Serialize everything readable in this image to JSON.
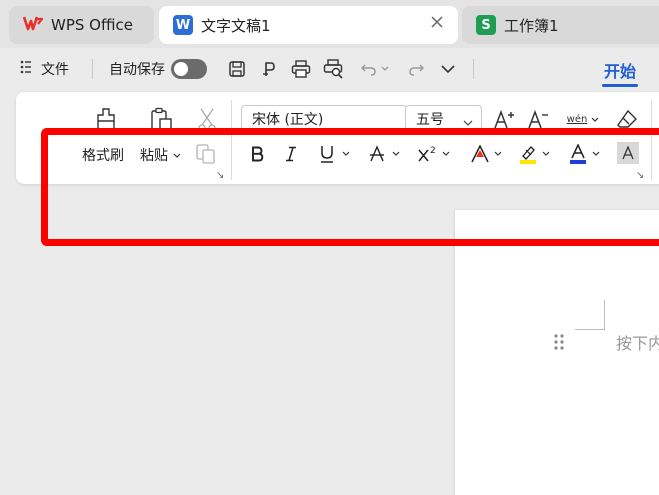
{
  "tabs": {
    "wps_label": "WPS Office",
    "doc_label": "文字文稿1",
    "sheet_label": "工作簿1",
    "doc_logo": "W",
    "sheet_logo": "S"
  },
  "menu": {
    "file_label": "文件",
    "autosave_label": "自动保存",
    "start_tab_label": "开始"
  },
  "ribbon": {
    "font_name": "宋体 (正文)",
    "font_size": "五号",
    "format_painter_label": "格式刷",
    "paste_label": "粘贴",
    "phonetic_label": "wén"
  },
  "document": {
    "placeholder": "按下内"
  },
  "colors": {
    "accent": "#1f5fd0",
    "highlight_border": "#ff0000",
    "wps_red": "#e8312a",
    "doc_blue": "#2b6fd6",
    "sheet_green": "#1f9d55",
    "highlighter_yellow": "#ffe600",
    "font_color_blue": "#1d3fd6"
  }
}
